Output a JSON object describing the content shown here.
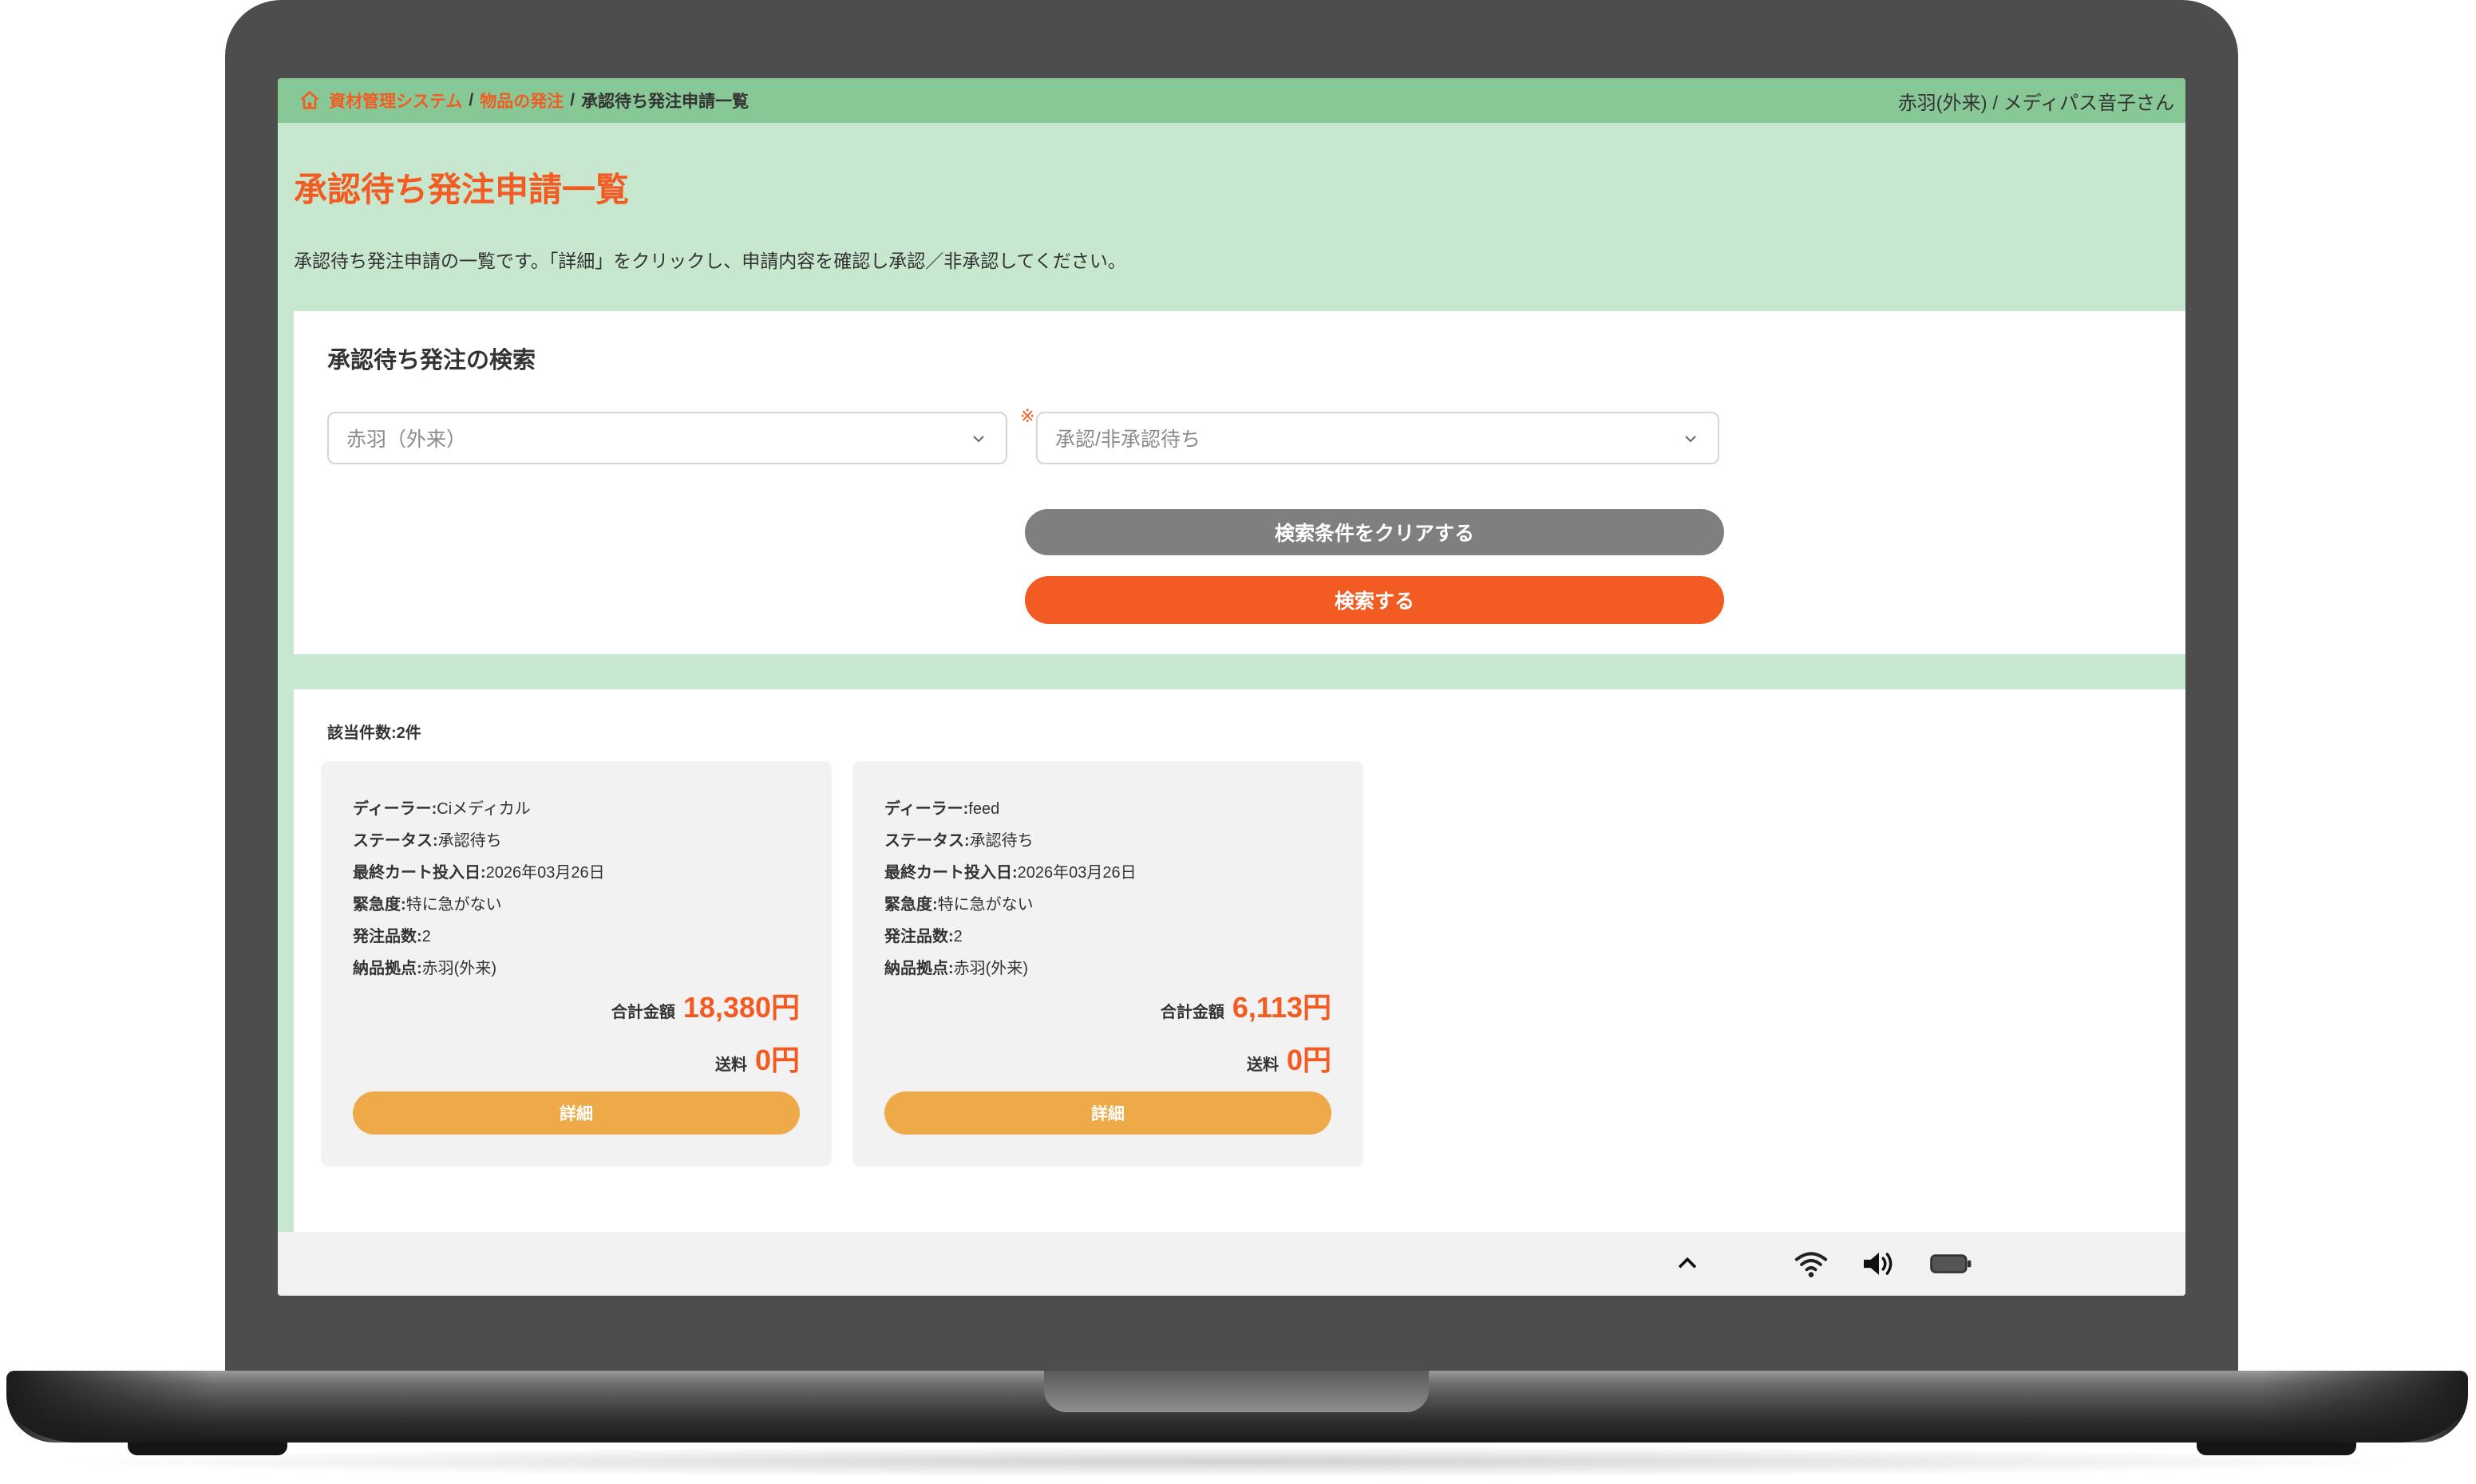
{
  "breadcrumb": {
    "home": "資材管理システム",
    "parent": "物品の発注",
    "current": "承認待ち発注申請一覧",
    "separator": "/"
  },
  "user": {
    "name": "赤羽(外来) /  メディパス音子さん"
  },
  "page": {
    "title": "承認待ち発注申請一覧",
    "description": "承認待ち発注申請の一覧です。「詳細」をクリックし、申請内容を確認し承認／非承認してください。"
  },
  "search": {
    "title": "承認待ち発注の検索",
    "location_select": "赤羽（外来）",
    "status_select": "承認/非承認待ち",
    "required_mark": "※",
    "clear_label": "検索条件をクリアする",
    "search_label": "検索する"
  },
  "results": {
    "count_text": "該当件数:2件",
    "cards": [
      {
        "dealer_label": "ディーラー:",
        "dealer": "Ciメディカル",
        "status_label": "ステータス:",
        "status": "承認待ち",
        "date_label": "最終カート投入日:",
        "date": "2026年03月26日",
        "urgency_label": "緊急度:",
        "urgency": "特に急がない",
        "items_label": "発注品数:",
        "items": "2",
        "location_label": "納品拠点:",
        "location": "赤羽(外来)",
        "total_label": "合計金額",
        "total": "18,380円",
        "shipping_label": "送料",
        "shipping": "0円",
        "detail_label": "詳細"
      },
      {
        "dealer_label": "ディーラー:",
        "dealer": "feed",
        "status_label": "ステータス:",
        "status": "承認待ち",
        "date_label": "最終カート投入日:",
        "date": "2026年03月26日",
        "urgency_label": "緊急度:",
        "urgency": "特に急がない",
        "items_label": "発注品数:",
        "items": "2",
        "location_label": "納品拠点:",
        "location": "赤羽(外来)",
        "total_label": "合計金額",
        "total": "6,113円",
        "shipping_label": "送料",
        "shipping": "0円",
        "detail_label": "詳細"
      }
    ]
  },
  "taskbar": {
    "icons": [
      "chevron-up-icon",
      "wifi-icon",
      "volume-icon",
      "battery-icon"
    ]
  },
  "colors": {
    "accent": "#f25c22",
    "header_bg": "#88c896",
    "page_bg": "#c7e7cf",
    "clear_button": "#7f7f7f",
    "detail_button": "#eeaa48",
    "card_bg": "#f2f2f2"
  }
}
